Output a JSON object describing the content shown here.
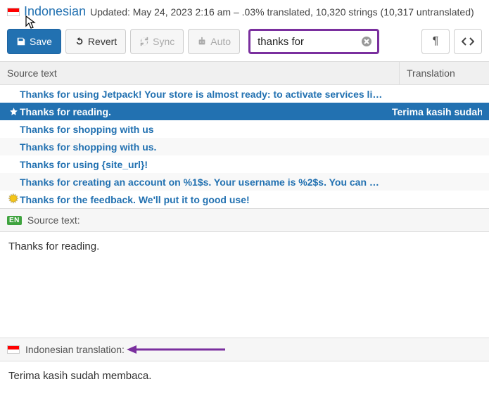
{
  "header": {
    "language": "Indonesian",
    "meta": "Updated: May 24, 2023 2:16 am – .03% translated, 10,320 strings (10,317 untranslated)"
  },
  "toolbar": {
    "save": "Save",
    "revert": "Revert",
    "sync": "Sync",
    "auto": "Auto",
    "search_value": "thanks for"
  },
  "columns": {
    "source": "Source text",
    "translation": "Translation"
  },
  "rows": [
    {
      "text": "Thanks for using Jetpack! Your store is almost ready: to activate services li…",
      "translation": "",
      "icon": ""
    },
    {
      "text": "Thanks for reading.",
      "translation": "Terima kasih sudah m",
      "icon": "star",
      "selected": true
    },
    {
      "text": "Thanks for shopping with us",
      "translation": "",
      "icon": ""
    },
    {
      "text": "Thanks for shopping with us.",
      "translation": "",
      "icon": ""
    },
    {
      "text": "Thanks for using {site_url}!",
      "translation": "",
      "icon": ""
    },
    {
      "text": "Thanks for creating an account on %1$s. Your username is %2$s. You can …",
      "translation": "",
      "icon": ""
    },
    {
      "text": "Thanks for the feedback. We'll put it to good use!",
      "translation": "",
      "icon": "burst"
    }
  ],
  "source_panel": {
    "badge": "EN",
    "label": "Source text:",
    "text": "Thanks for reading."
  },
  "translation_panel": {
    "label": "Indonesian translation:",
    "text": "Terima kasih sudah membaca."
  },
  "colors": {
    "accent_purple": "#7a2f9e"
  }
}
